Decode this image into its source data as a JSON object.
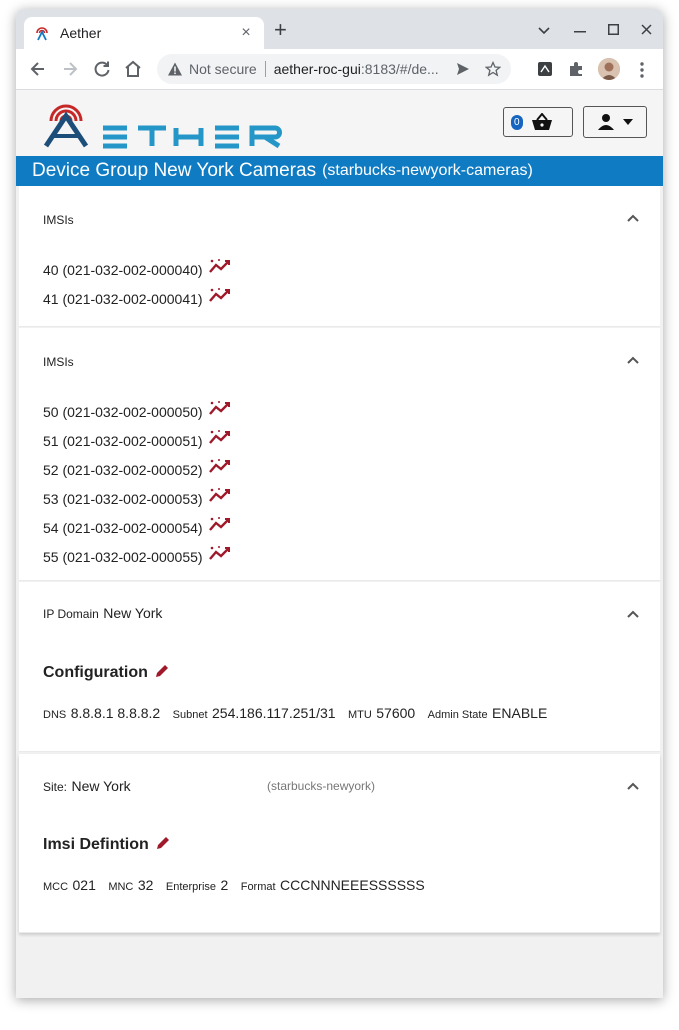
{
  "browser": {
    "tab_title": "Aether",
    "tab_close": "×",
    "new_tab": "+",
    "not_secure": "Not secure",
    "url_host": "aether-roc-gui",
    "url_rest": ":8183/#/de..."
  },
  "header": {
    "basket_count": "0"
  },
  "page": {
    "title": "Device Group New York Cameras",
    "title_id": "(starbucks-newyork-cameras)"
  },
  "imsi_panels": [
    {
      "label": "IMSIs",
      "items": [
        "40 (021-032-002-000040)",
        "41 (021-032-002-000041)"
      ]
    },
    {
      "label": "IMSIs",
      "items": [
        "50 (021-032-002-000050)",
        "51 (021-032-002-000051)",
        "52 (021-032-002-000052)",
        "53 (021-032-002-000053)",
        "54 (021-032-002-000054)",
        "55 (021-032-002-000055)"
      ]
    }
  ],
  "ip_domain": {
    "label": "IP Domain",
    "value": "New York",
    "config_heading": "Configuration",
    "dns_label": "DNS",
    "dns_value": "8.8.8.1 8.8.8.2",
    "subnet_label": "Subnet",
    "subnet_value": "254.186.117.251/31",
    "mtu_label": "MTU",
    "mtu_value": "57600",
    "admin_label": "Admin State",
    "admin_value": "ENABLE"
  },
  "site": {
    "label": "Site:",
    "value": "New York",
    "id": "(starbucks-newyork)",
    "imsi_heading": "Imsi Defintion",
    "mcc_label": "MCC",
    "mcc_value": "021",
    "mnc_label": "MNC",
    "mnc_value": "32",
    "enterprise_label": "Enterprise",
    "enterprise_value": "2",
    "format_label": "Format",
    "format_value": "CCCNNNEEESSSSSS"
  },
  "colors": {
    "brand_blue": "#0f7bc2",
    "icon_red": "#a0192b",
    "badge_blue": "#1565c0"
  }
}
